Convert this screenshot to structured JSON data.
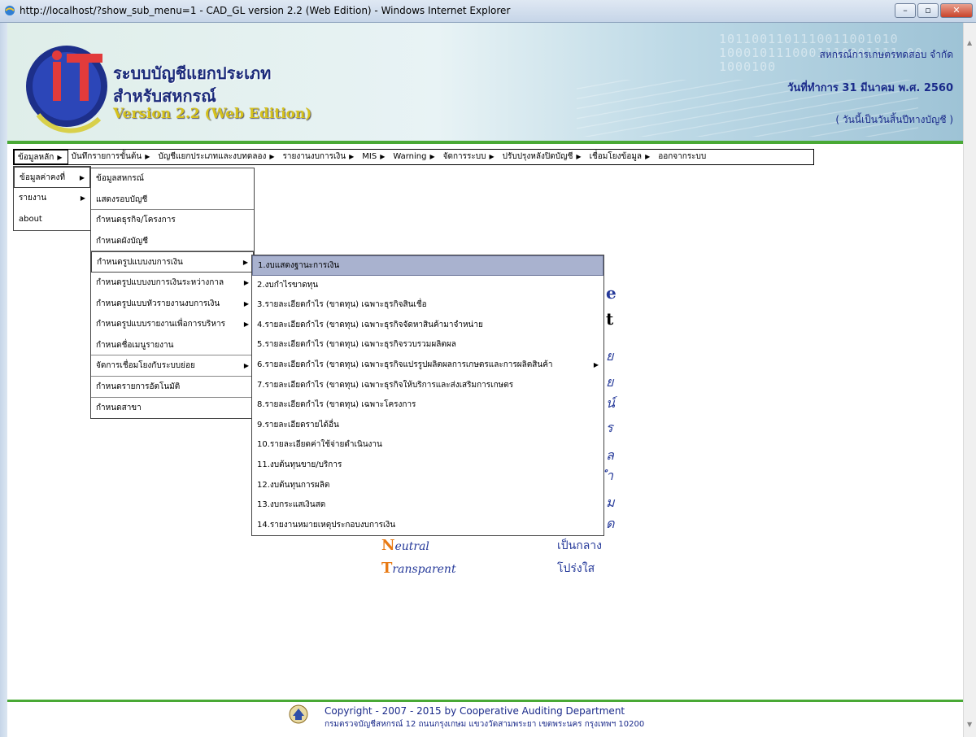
{
  "window": {
    "title": "http://localhost/?show_sub_menu=1 - CAD_GL version 2.2 (Web Edition) - Windows Internet Explorer",
    "minimize": "–",
    "maximize": "▫",
    "close": "✕"
  },
  "banner": {
    "title_line1": "ระบบบัญชีแยกประเภท",
    "title_line2": "สำหรับสหกรณ์",
    "version": "Version 2.2 (Web Edition)",
    "coop_name": "สหกรณ์การเกษตรทดสอบ จำกัด",
    "date_line": "วันที่ทำการ 31 มีนาคม พ.ศ. 2560",
    "note": "( วันนี้เป็นวันสิ้นปีทางบัญชี )",
    "binary_text": "1011001101110011001010 1000101110001110001111 00 1000100"
  },
  "menubar": {
    "items": [
      {
        "label": "ข้อมูลหลัก",
        "arrow": "▶"
      },
      {
        "label": "บันทึกรายการขั้นต้น",
        "arrow": "▶"
      },
      {
        "label": "บัญชีแยกประเภทและงบทดลอง",
        "arrow": "▶"
      },
      {
        "label": "รายงานงบการเงิน",
        "arrow": "▶"
      },
      {
        "label": "MIS",
        "arrow": "▶"
      },
      {
        "label": "Warning",
        "arrow": "▶"
      },
      {
        "label": "จัดการระบบ",
        "arrow": "▶"
      },
      {
        "label": "ปรับปรุงหลังปิดบัญชี",
        "arrow": "▶"
      },
      {
        "label": "เชื่อมโยงข้อมูล",
        "arrow": "▶"
      },
      {
        "label": "ออกจากระบบ",
        "arrow": ""
      }
    ]
  },
  "menu1": {
    "items": [
      {
        "label": "ข้อมูลค่าคงที่",
        "arrow": "▶"
      },
      {
        "label": "รายงาน",
        "arrow": "▶"
      },
      {
        "label": "about",
        "arrow": ""
      }
    ]
  },
  "menu2": {
    "items": [
      {
        "label": "ข้อมูลสหกรณ์",
        "arrow": ""
      },
      {
        "label": "แสดงรอบบัญชี",
        "arrow": ""
      },
      {
        "label": "กำหนดธุรกิจ/โครงการ",
        "arrow": ""
      },
      {
        "label": "กำหนดผังบัญชี",
        "arrow": ""
      },
      {
        "label": "กำหนดรูปแบบงบการเงิน",
        "arrow": "▶"
      },
      {
        "label": "กำหนดรูปแบบงบการเงินระหว่างกาล",
        "arrow": "▶"
      },
      {
        "label": "กำหนดรูปแบบหัวรายงานงบการเงิน",
        "arrow": "▶"
      },
      {
        "label": "กำหนดรูปแบบรายงานเพื่อการบริหาร",
        "arrow": "▶"
      },
      {
        "label": "กำหนดชื่อเมนูรายงาน",
        "arrow": ""
      },
      {
        "label": "จัดการเชื่อมโยงกับระบบย่อย",
        "arrow": "▶"
      },
      {
        "label": "กำหนดรายการอัตโนมัติ",
        "arrow": ""
      },
      {
        "label": "กำหนดสาขา",
        "arrow": ""
      }
    ]
  },
  "menu3": {
    "items": [
      {
        "label": "1.งบแสดงฐานะการเงิน",
        "arrow": ""
      },
      {
        "label": "2.งบกำไรขาดทุน",
        "arrow": ""
      },
      {
        "label": "3.รายละเอียดกำไร (ขาดทุน) เฉพาะธุรกิจสินเชื่อ",
        "arrow": ""
      },
      {
        "label": "4.รายละเอียดกำไร (ขาดทุน) เฉพาะธุรกิจจัดหาสินค้ามาจำหน่าย",
        "arrow": ""
      },
      {
        "label": "5.รายละเอียดกำไร (ขาดทุน) เฉพาะธุรกิจรวบรวมผลิตผล",
        "arrow": ""
      },
      {
        "label": "6.รายละเอียดกำไร (ขาดทุน) เฉพาะธุรกิจแปรรูปผลิตผลการเกษตรและการผลิตสินค้า",
        "arrow": "▶"
      },
      {
        "label": "7.รายละเอียดกำไร (ขาดทุน) เฉพาะธุรกิจให้บริการและส่งเสริมการเกษตร",
        "arrow": ""
      },
      {
        "label": "8.รายละเอียดกำไร (ขาดทุน) เฉพาะโครงการ",
        "arrow": ""
      },
      {
        "label": "9.รายละเอียดรายได้อื่น",
        "arrow": ""
      },
      {
        "label": "10.รายละเอียดค่าใช้จ่ายดำเนินงาน",
        "arrow": ""
      },
      {
        "label": "11.งบต้นทุนขาย/บริการ",
        "arrow": ""
      },
      {
        "label": "12.งบต้นทุนการผลิต",
        "arrow": ""
      },
      {
        "label": "13.งบกระแสเงินสด",
        "arrow": ""
      },
      {
        "label": "14.รายงานหมายเหตุประกอบงบการเงิน",
        "arrow": ""
      }
    ]
  },
  "background": {
    "neutral_en_cap": "N",
    "neutral_en_rest": "eutral",
    "neutral_th": "เป็นกลาง",
    "transparent_en_cap": "T",
    "transparent_en_rest": "ransparent",
    "transparent_th": "โปร่งใส",
    "partial_glyphs": [
      "e",
      "t",
      "ย",
      "ย",
      "น์",
      "ร",
      "ล",
      "ำ",
      "ม",
      "ด"
    ]
  },
  "footer": {
    "copyright": "Copyright - 2007 - 2015 by Cooperative Auditing Department",
    "address": "กรมตรวจบัญชีสหกรณ์ 12 ถนนกรุงเกษม แขวงวัดสามพระยา เขตพระนคร กรุงเทพฯ 10200"
  },
  "colors": {
    "accent_green": "#49a935",
    "text_blue": "#1a2a8a",
    "highlight": "#a9b2cf",
    "orange": "#e87a14"
  }
}
